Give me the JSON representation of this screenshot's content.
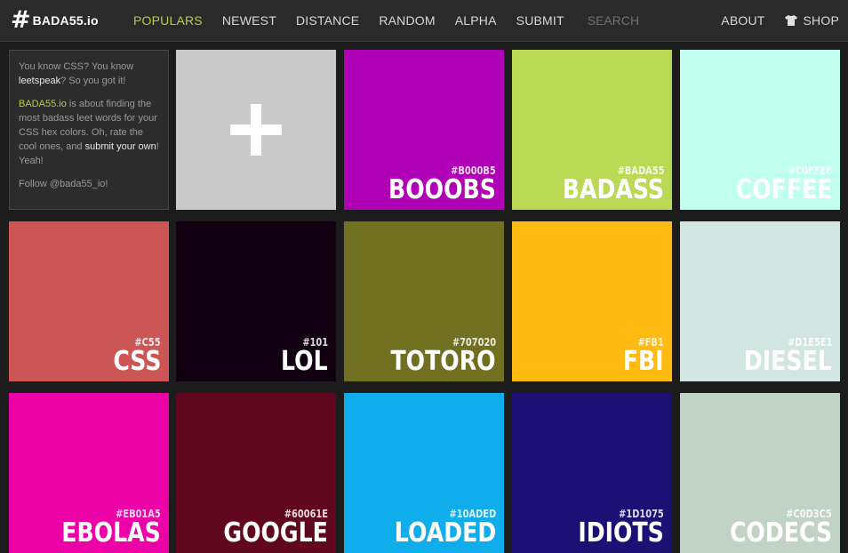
{
  "header": {
    "logo_hash": "#",
    "logo_text": "BADA55.io",
    "nav": [
      "POPULARS",
      "NEWEST",
      "DISTANCE",
      "RANDOM",
      "ALPHA",
      "SUBMIT"
    ],
    "search_placeholder": "SEARCH",
    "about": "ABOUT",
    "shop": "SHOP"
  },
  "intro": {
    "p1_a": "You know CSS? You know ",
    "p1_b": "leetspeak",
    "p1_c": "? So you got it!",
    "p2_brand": "BADA55.io",
    "p2_a": " is about finding the most badass leet words for your CSS hex colors. Oh, rate the cool ones, and ",
    "p2_b": "submit your own",
    "p2_c": "! Yeah!",
    "p3_a": "Follow ",
    "p3_b": "@bada55_io",
    "p3_c": "!"
  },
  "colors": {
    "add_tile": "#cacaca",
    "accent": "#b5cd4a"
  },
  "tiles": [
    {
      "hex": "#B000B5",
      "word": "BOOOBS",
      "color": "#B000B5"
    },
    {
      "hex": "#BADA55",
      "word": "BADASS",
      "color": "#BADA55"
    },
    {
      "hex": "#C0FFEE",
      "word": "COFFEE",
      "color": "#C0FFEE"
    },
    {
      "hex": "#C55",
      "word": "CSS",
      "color": "#CC5555"
    },
    {
      "hex": "#101",
      "word": "LOL",
      "color": "#110011"
    },
    {
      "hex": "#707020",
      "word": "TOTORO",
      "color": "#707020"
    },
    {
      "hex": "#FB1",
      "word": "FBI",
      "color": "#FFBB11"
    },
    {
      "hex": "#D1E5E1",
      "word": "DIESEL",
      "color": "#D1E5E1"
    },
    {
      "hex": "#EB01A5",
      "word": "EBOLAS",
      "color": "#EB01A5"
    },
    {
      "hex": "#60061E",
      "word": "GOOGLE",
      "color": "#60061E"
    },
    {
      "hex": "#10ADED",
      "word": "LOADED",
      "color": "#10ADED"
    },
    {
      "hex": "#1D1075",
      "word": "IDIOTS",
      "color": "#1D1075"
    },
    {
      "hex": "#C0D3C5",
      "word": "CODECS",
      "color": "#C0D3C5"
    }
  ]
}
